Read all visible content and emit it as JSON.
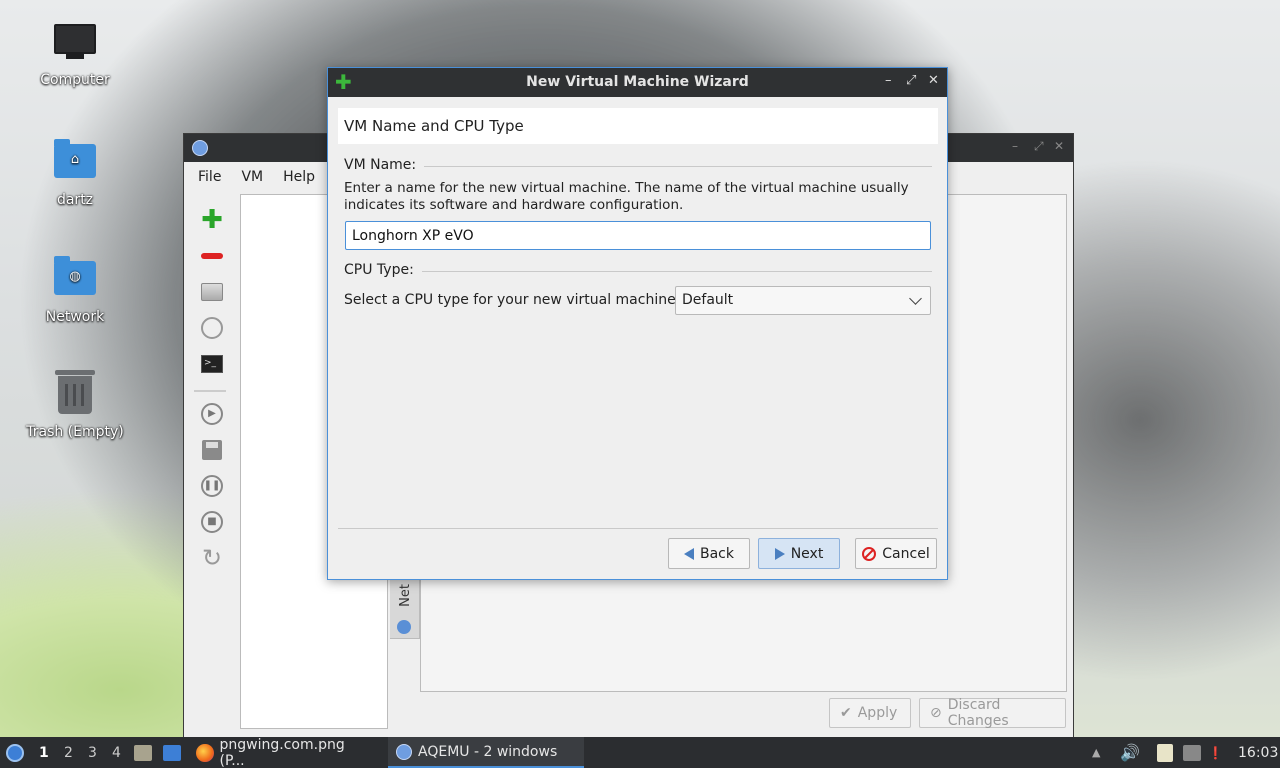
{
  "desktop": {
    "icons": [
      {
        "label": "Computer",
        "icon": "computer-icon"
      },
      {
        "label": "dartz",
        "icon": "home-folder-icon"
      },
      {
        "label": "Network",
        "icon": "network-folder-icon"
      },
      {
        "label": "Trash (Empty)",
        "icon": "trash-icon"
      }
    ]
  },
  "aqemu": {
    "title": "AQEMU",
    "menu": [
      "File",
      "VM",
      "Help"
    ],
    "side_tab_label": "Net",
    "apply_label": "Apply",
    "discard_label": "Discard Changes"
  },
  "wizard": {
    "title": "New Virtual Machine Wizard",
    "page_title": "VM Name and CPU Type",
    "vm_name_section": "VM Name:",
    "vm_name_desc": "Enter a name for the new virtual machine. The name of the virtual machine usually indicates its software and hardware configuration.",
    "vm_name_value": "Longhorn XP eVO",
    "cpu_section": "CPU Type:",
    "cpu_label": "Select a CPU type for your new virtual machine:",
    "cpu_value": "Default",
    "back_label": "Back",
    "next_label": "Next",
    "cancel_label": "Cancel"
  },
  "taskbar": {
    "workspaces": [
      "1",
      "2",
      "3",
      "4"
    ],
    "tasks": [
      {
        "label": "pngwing.com.png (P..."
      },
      {
        "label": "AQEMU - 2 windows"
      }
    ],
    "clock": "16:03"
  },
  "colors": {
    "accent": "#4a90d9",
    "titlebar": "#2f3133",
    "add_green": "#2aa52a",
    "remove_red": "#dd2222"
  }
}
